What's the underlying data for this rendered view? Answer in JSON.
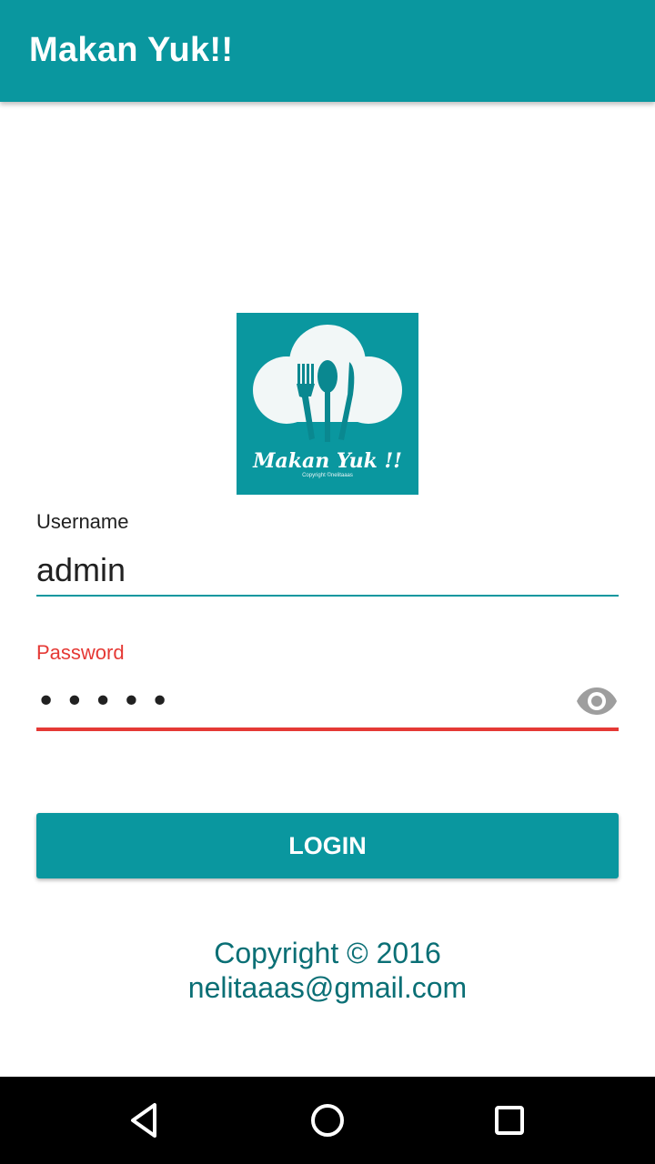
{
  "app_bar": {
    "title": "Makan Yuk!!"
  },
  "logo": {
    "text": "Makan Yuk !!",
    "subtext": "Copyright ©nelitaaas",
    "icon": "chef-hat-cutlery-logo"
  },
  "form": {
    "username": {
      "label": "Username",
      "value": "admin"
    },
    "password": {
      "label": "Password",
      "masked_value": "•••••",
      "toggle_icon": "eye-icon"
    },
    "login_label": "LOGIN"
  },
  "footer": {
    "line1": "Copyright © 2016",
    "line2": "nelitaaas@gmail.com"
  },
  "nav_bar": {
    "back_icon": "back-triangle-icon",
    "home_icon": "home-circle-icon",
    "recents_icon": "recents-square-icon"
  },
  "colors": {
    "primary": "#0a979f",
    "error": "#e53935",
    "footer_text": "#0a6f75"
  }
}
